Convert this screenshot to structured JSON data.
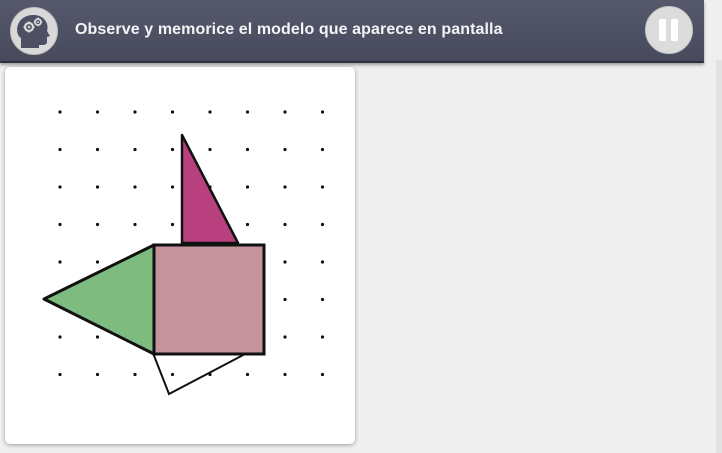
{
  "header": {
    "title": "Observe y memorice el modelo que aparece en pantalla",
    "logo_icon": "head-gears-icon",
    "pause_icon": "pause-icon"
  },
  "model": {
    "grid": {
      "columns": 8,
      "rows": 8
    },
    "shapes": [
      {
        "name": "magenta-triangle",
        "kind": "triangle",
        "fill": "#b9407f",
        "stroke": "#111111"
      },
      {
        "name": "pink-square",
        "kind": "square",
        "fill": "#c4949d",
        "stroke": "#111111"
      },
      {
        "name": "green-triangle",
        "kind": "triangle",
        "fill": "#7dbb7f",
        "stroke": "#111111"
      },
      {
        "name": "outline-triangle",
        "kind": "triangle",
        "fill": "none",
        "stroke": "#111111"
      }
    ]
  }
}
